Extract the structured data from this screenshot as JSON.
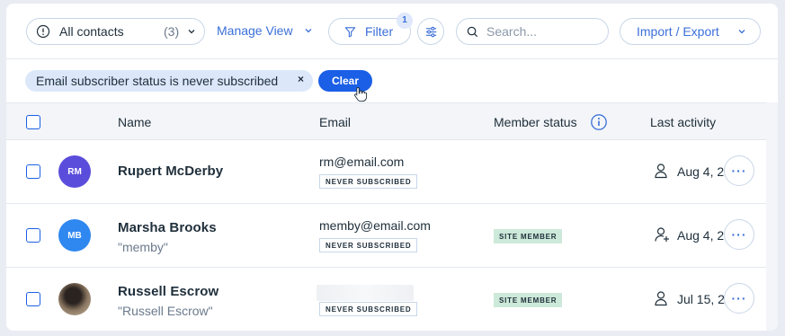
{
  "toolbar": {
    "contacts_label": "All contacts",
    "contacts_count": "(3)",
    "manage_view_label": "Manage View",
    "filter_label": "Filter",
    "filter_badge": "1",
    "search_placeholder": "Search...",
    "import_export_label": "Import / Export"
  },
  "filter_chip": {
    "text": "Email subscriber status is never subscribed",
    "remove_glyph": "×",
    "clear_label": "Clear"
  },
  "table": {
    "columns": [
      "Name",
      "Email",
      "Member status",
      "Last activity"
    ],
    "rows": [
      {
        "initials": "RM",
        "avatar_color": "#5b4ddb",
        "name": "Rupert McDerby",
        "nickname": "",
        "email": "rm@email.com",
        "subscriber_tag": "NEVER SUBSCRIBED",
        "member_tag": "",
        "activity_icon": "person-icon",
        "last_activity": "Aug 4, 2"
      },
      {
        "initials": "MB",
        "avatar_color": "#2f87f0",
        "name": "Marsha Brooks",
        "nickname": "\"memby\"",
        "email": "memby@email.com",
        "subscriber_tag": "NEVER SUBSCRIBED",
        "member_tag": "SITE MEMBER",
        "activity_icon": "person-add-icon",
        "last_activity": "Aug 4, 2"
      },
      {
        "initials": "",
        "avatar_color": "#6b5a4a",
        "name": "Russell Escrow",
        "nickname": "\"Russell Escrow\"",
        "email": "",
        "subscriber_tag": "NEVER SUBSCRIBED",
        "member_tag": "SITE MEMBER",
        "activity_icon": "person-icon",
        "last_activity": "Jul 15, 2"
      }
    ]
  },
  "colors": {
    "accent": "#1b5fe6",
    "chip_bg": "#dce8fa",
    "site_member_bg": "#cde9d9"
  }
}
